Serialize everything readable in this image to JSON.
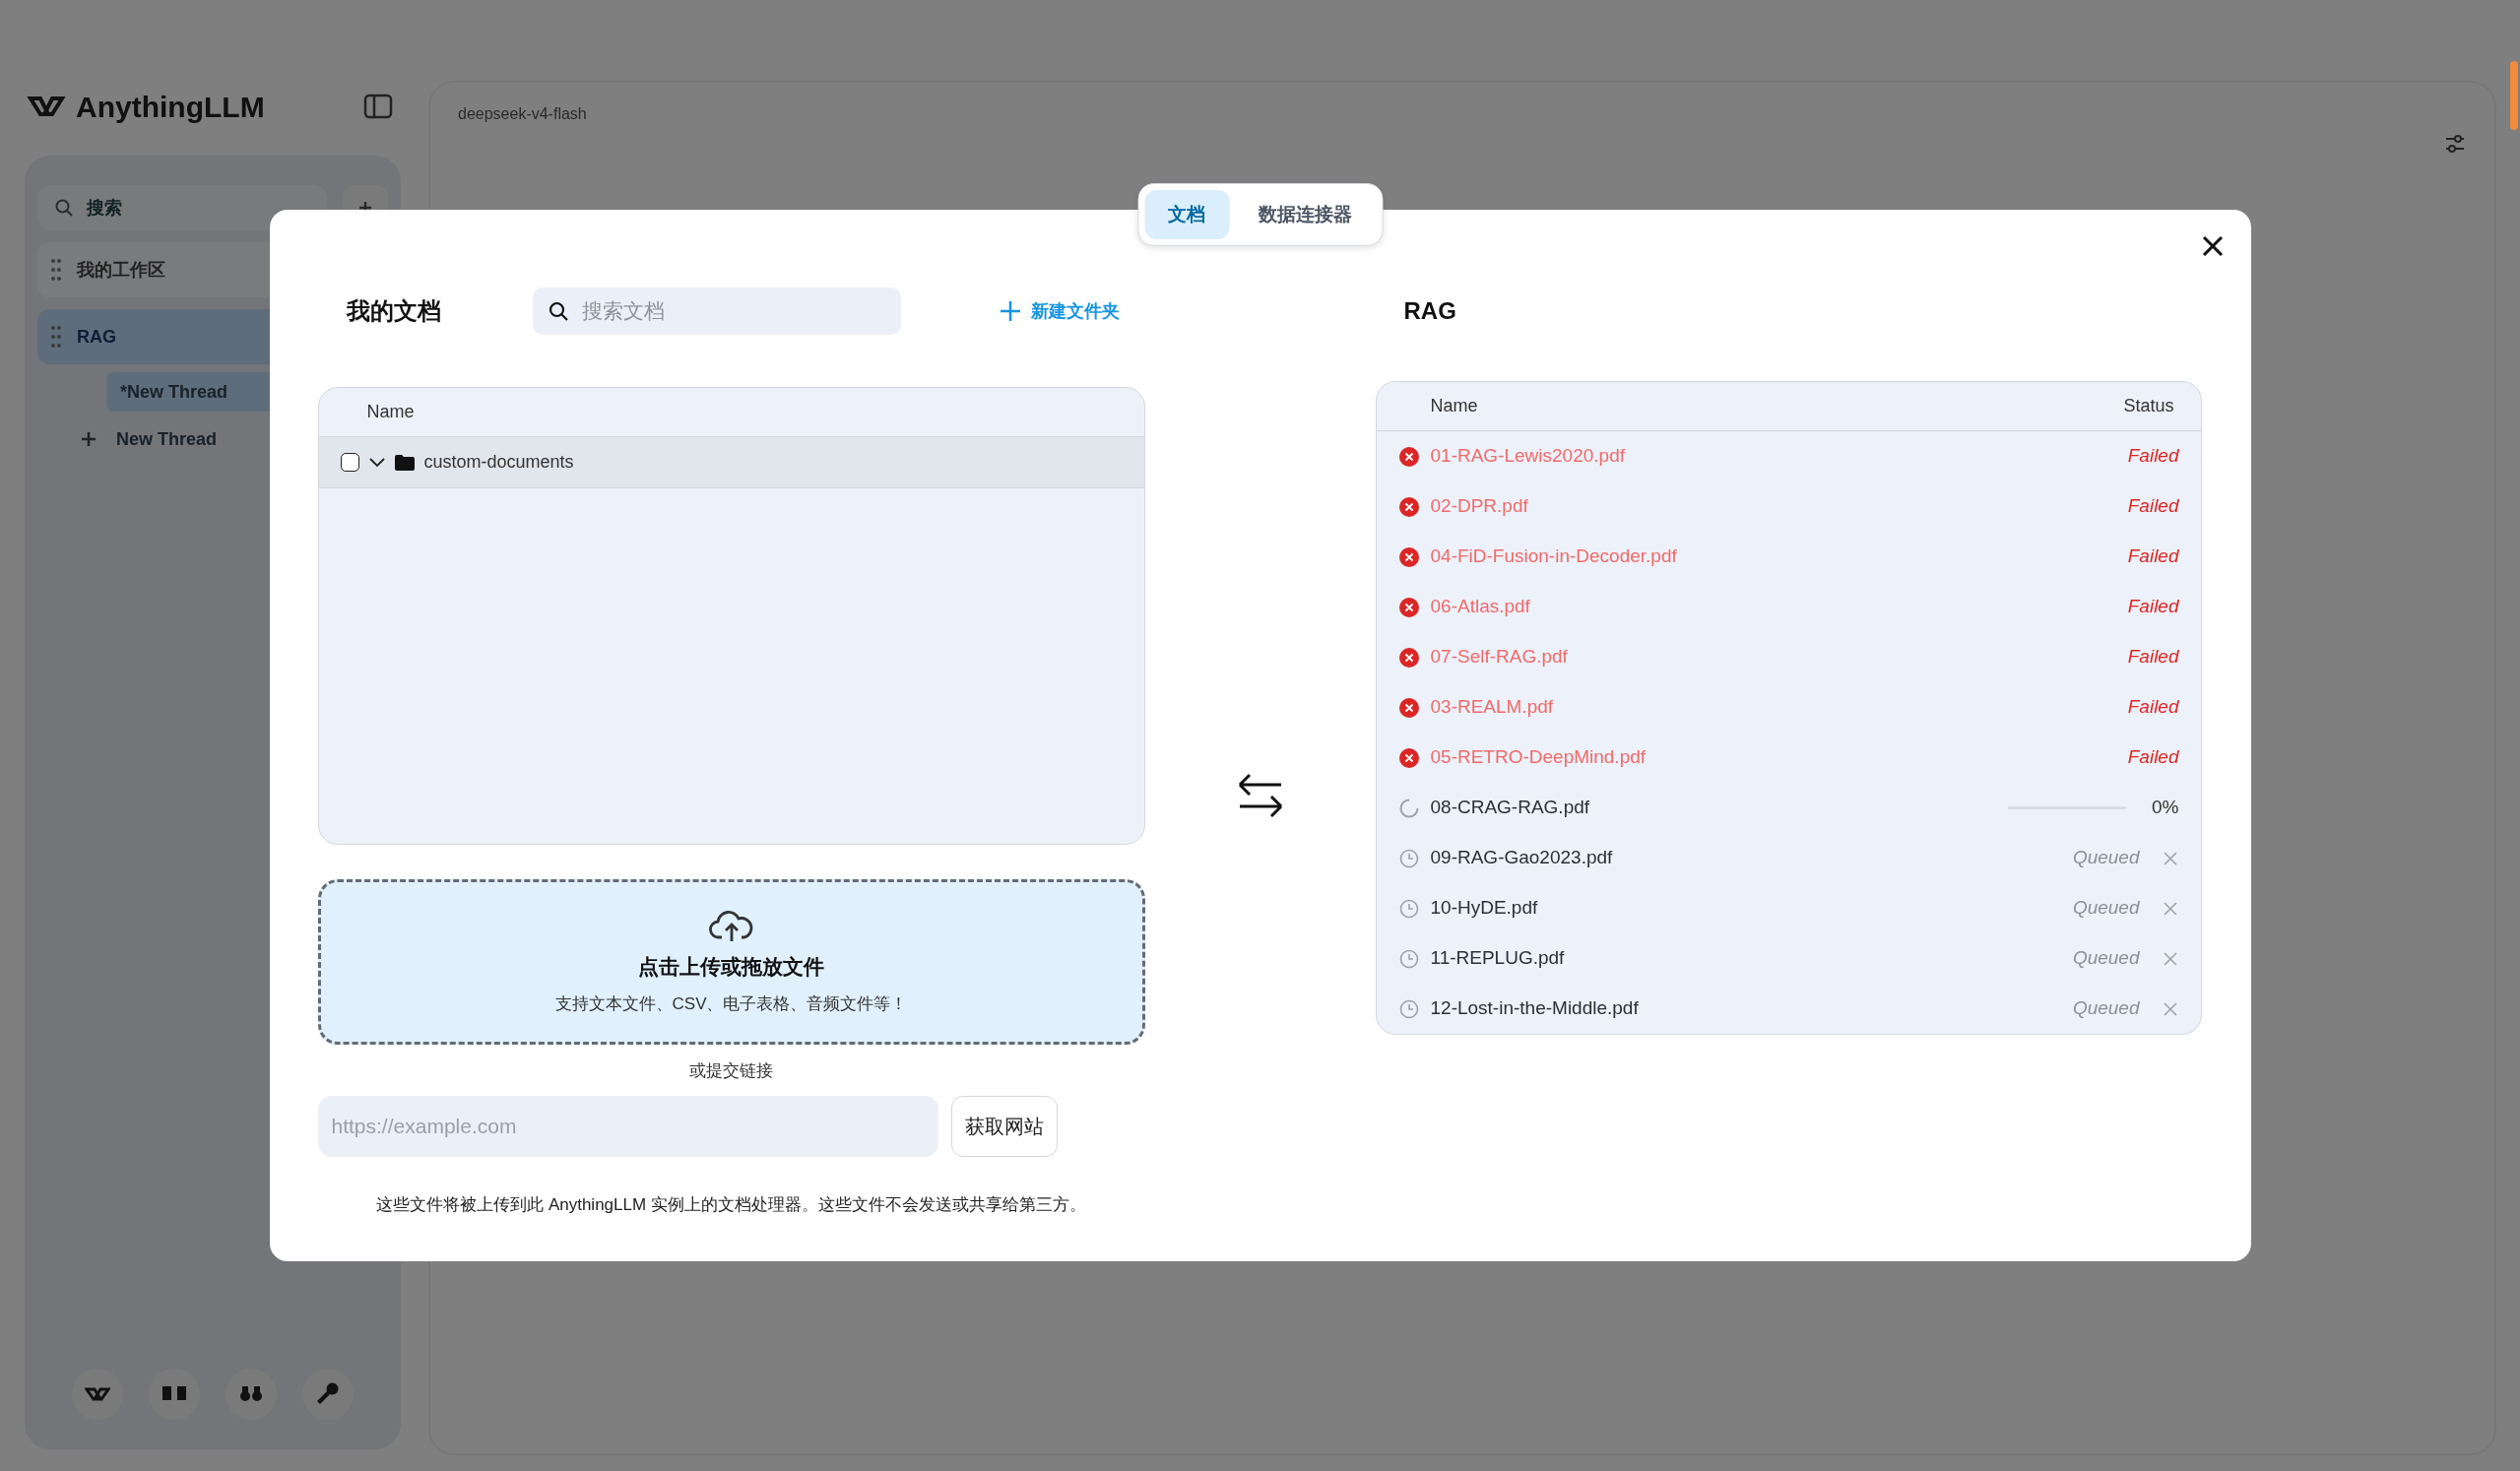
{
  "app": {
    "logo": "AnythingLLM",
    "search_placeholder": "搜索",
    "sidebar_items": [
      {
        "label": "我的工作区",
        "selected": false
      },
      {
        "label": "RAG",
        "selected": true,
        "threads": [
          {
            "label": "*New Thread",
            "kind": "thread",
            "selected": true
          },
          {
            "label": "New Thread",
            "kind": "new",
            "selected": false
          }
        ]
      }
    ],
    "model": "deepseek-v4-flash"
  },
  "modal": {
    "tabs": [
      {
        "label": "文档",
        "selected": true
      },
      {
        "label": "数据连接器",
        "selected": false
      }
    ],
    "my_documents": {
      "title": "我的文档",
      "search_placeholder": "搜索文档",
      "new_folder": "新建文件夹",
      "columns": [
        "Name"
      ],
      "rows": [
        {
          "name": "custom-documents",
          "checked": false
        }
      ]
    },
    "upload": {
      "title": "点击上传或拖放文件",
      "subtitle": "支持文本文件、CSV、电子表格、音频文件等！",
      "or_link": "或提交链接",
      "url_placeholder": "https://example.com",
      "fetch_button": "获取网站",
      "note": "这些文件将被上传到此 AnythingLLM 实例上的文档处理器。这些文件不会发送或共享给第三方。"
    },
    "workspace": {
      "title": "RAG",
      "columns": [
        "Name",
        "Status"
      ],
      "files": [
        {
          "name": "01-RAG-Lewis2020.pdf",
          "kind": "failed",
          "status": "Failed"
        },
        {
          "name": "02-DPR.pdf",
          "kind": "failed",
          "status": "Failed"
        },
        {
          "name": "04-FiD-Fusion-in-Decoder.pdf",
          "kind": "failed",
          "status": "Failed"
        },
        {
          "name": "06-Atlas.pdf",
          "kind": "failed",
          "status": "Failed"
        },
        {
          "name": "07-Self-RAG.pdf",
          "kind": "failed",
          "status": "Failed"
        },
        {
          "name": "03-REALM.pdf",
          "kind": "failed",
          "status": "Failed"
        },
        {
          "name": "05-RETRO-DeepMind.pdf",
          "kind": "failed",
          "status": "Failed"
        },
        {
          "name": "08-CRAG-RAG.pdf",
          "kind": "processing",
          "level": 0,
          "status": "0%"
        },
        {
          "name": "09-RAG-Gao2023.pdf",
          "kind": "queued",
          "status": "Queued"
        },
        {
          "name": "10-HyDE.pdf",
          "kind": "queued",
          "status": "Queued"
        },
        {
          "name": "11-REPLUG.pdf",
          "kind": "queued",
          "status": "Queued"
        },
        {
          "name": "12-Lost-in-the-Middle.pdf",
          "kind": "queued",
          "status": "Queued"
        }
      ]
    }
  }
}
